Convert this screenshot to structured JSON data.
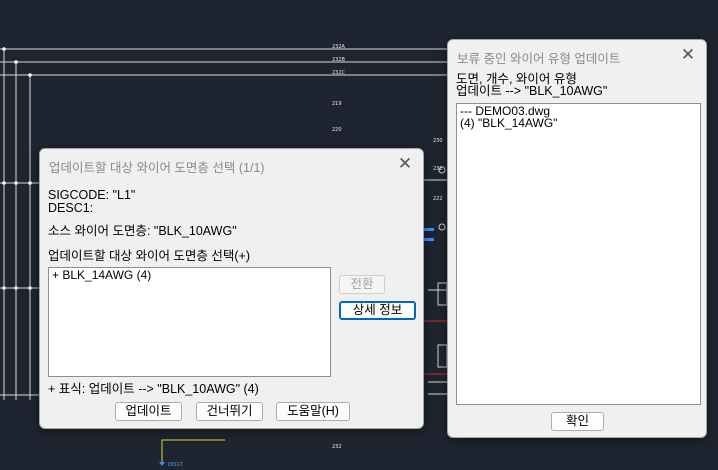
{
  "cad": {
    "labels": [
      "232A",
      "232B",
      "232C",
      "219",
      "220",
      "230",
      "232",
      "222",
      "232",
      "DIS17"
    ]
  },
  "update_dialog": {
    "title": "업데이트할 대상 와이어 도면층 선택 (1/1)",
    "sigcode": "SIGCODE: \"L1\"",
    "desc1": "DESC1:",
    "source_layer": "소스 와이어 도면층:  \"BLK_10AWG\"",
    "list_label": "업데이트할 대상 와이어 도면층 선택(+)",
    "list_items": [
      "+ BLK_14AWG  (4)"
    ],
    "switch_btn": "전환",
    "details_btn": "상세 정보",
    "legend": "+  표식: 업데이트 --> \"BLK_10AWG\"  (4)",
    "update_btn": "업데이트",
    "skip_btn": "건너뛰기",
    "help_btn": "도움말(H)"
  },
  "pending_dialog": {
    "title": "보류 중인 와이어 유형 업데이트",
    "header_line1": "도면, 개수, 와이어 유형",
    "header_line2": "업데이트 --> \"BLK_10AWG\"",
    "list_items": [
      "--- DEMO03.dwg",
      "(4)  \"BLK_14AWG\""
    ],
    "ok_btn": "확인"
  }
}
